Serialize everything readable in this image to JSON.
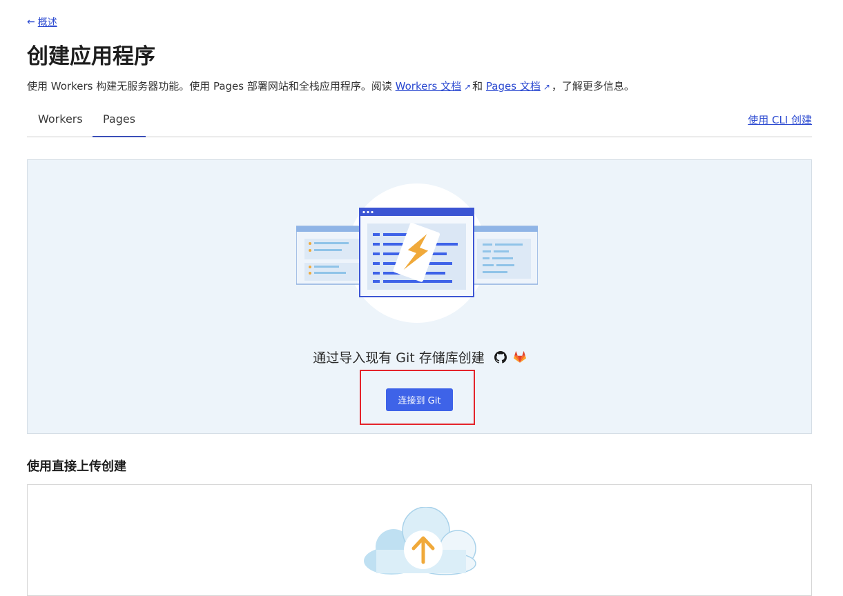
{
  "breadcrumb": {
    "back_label": "概述"
  },
  "page": {
    "title": "创建应用程序"
  },
  "intro": {
    "text_1": "使用 Workers 构建无服务器功能。使用 Pages 部署网站和全栈应用程序。阅读 ",
    "workers_docs_link": "Workers 文档",
    "text_2": "和 ",
    "pages_docs_link": "Pages 文档",
    "text_3": "，了解更多信息。"
  },
  "tabs": [
    {
      "label": "Workers",
      "selected": false
    },
    {
      "label": "Pages",
      "selected": true
    }
  ],
  "cli_link": "使用 CLI 创建",
  "git_section": {
    "prompt": "通过导入现有 Git 存储库创建",
    "providers": [
      "github-icon",
      "gitlab-icon"
    ],
    "connect_button": "连接到 Git"
  },
  "upload_section": {
    "title": "使用直接上传创建"
  },
  "colors": {
    "accent": "#3e63e8",
    "link": "#2d4bd1",
    "highlight": "#e4232b",
    "panel_bg": "#edf4fa"
  }
}
